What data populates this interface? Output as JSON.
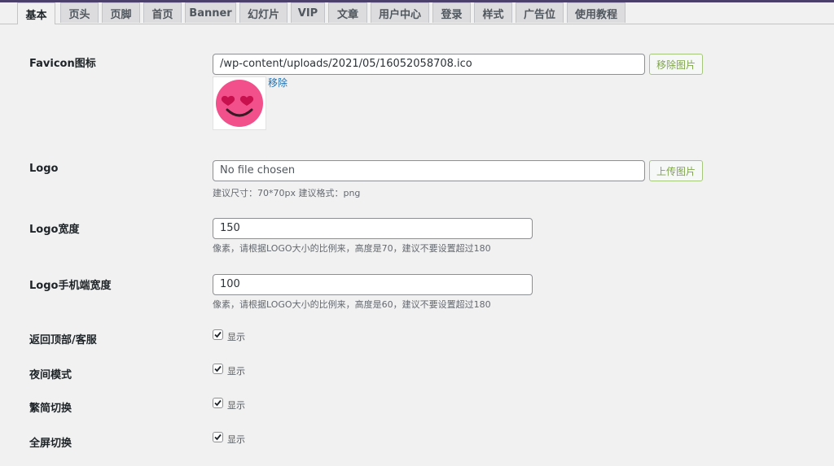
{
  "tabs": [
    {
      "label": "基本",
      "active": true
    },
    {
      "label": "页头"
    },
    {
      "label": "页脚"
    },
    {
      "label": "首页"
    },
    {
      "label": "Banner"
    },
    {
      "label": "幻灯片"
    },
    {
      "label": "VIP"
    },
    {
      "label": "文章"
    },
    {
      "label": "用户中心"
    },
    {
      "label": "登录"
    },
    {
      "label": "样式"
    },
    {
      "label": "广告位"
    },
    {
      "label": "使用教程"
    }
  ],
  "favicon": {
    "label": "Favicon图标",
    "value": "/wp-content/uploads/2021/05/16052058708.ico",
    "button": "移除图片",
    "remove_link": "移除",
    "preview_icon": "heart-eyes-emoji-icon"
  },
  "logo": {
    "label": "Logo",
    "value": "No file chosen",
    "button": "上传图片",
    "desc": "建议尺寸：70*70px 建议格式：png"
  },
  "logo_width": {
    "label": "Logo宽度",
    "value": "150",
    "desc": "像素，请根据LOGO大小的比例来，高度是70，建议不要设置超过180"
  },
  "logo_mobile_width": {
    "label": "Logo手机端宽度",
    "value": "100",
    "desc": "像素，请根据LOGO大小的比例来，高度是60，建议不要设置超过180"
  },
  "toggles": [
    {
      "label": "返回顶部/客服",
      "option": "显示",
      "checked": true
    },
    {
      "label": "夜间模式",
      "option": "显示",
      "checked": true
    },
    {
      "label": "繁简切换",
      "option": "显示",
      "checked": true
    },
    {
      "label": "全屏切换",
      "option": "显示",
      "checked": true
    }
  ],
  "colors": {
    "accent_button": "#7fa54a",
    "link": "#2271b1",
    "topbar": "#4b3f6b"
  }
}
